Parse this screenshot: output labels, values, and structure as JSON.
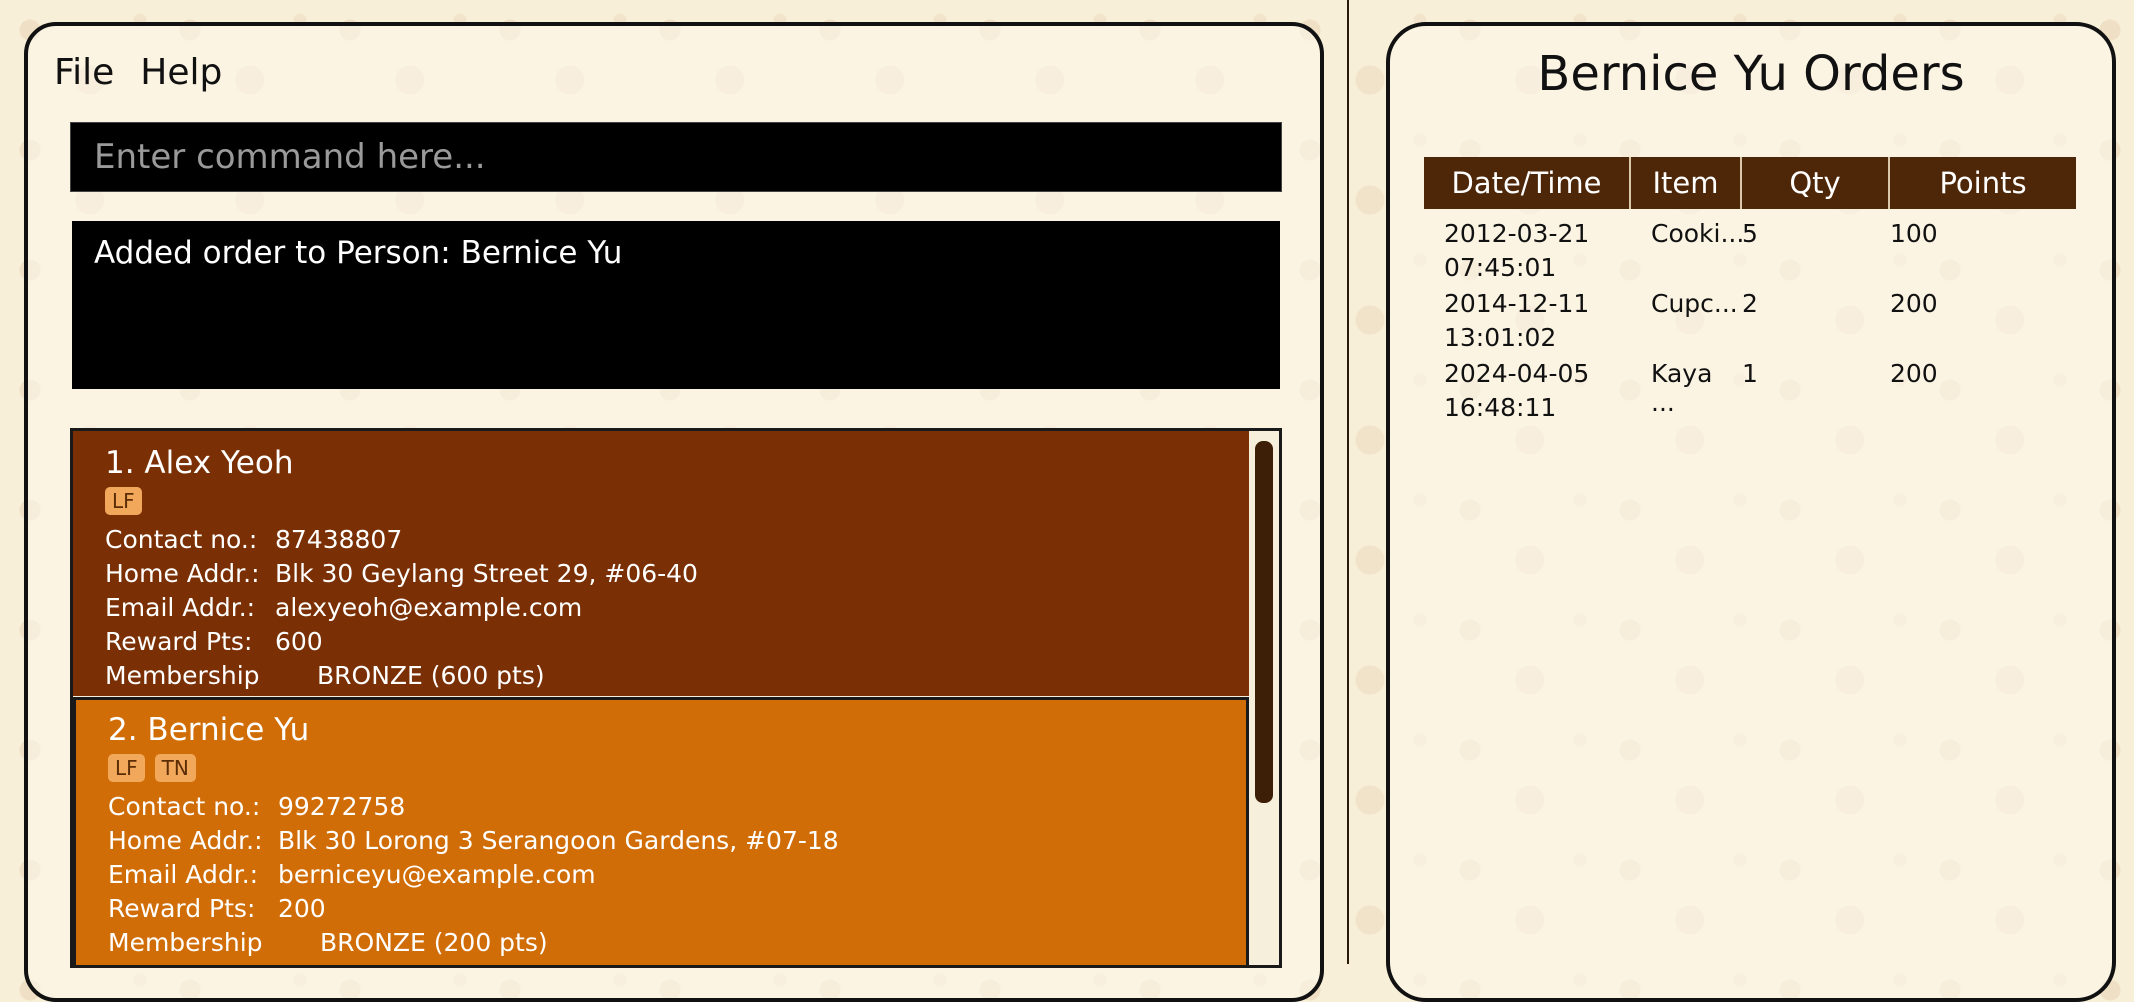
{
  "menu": {
    "file": "File",
    "help": "Help"
  },
  "command": {
    "placeholder": "Enter command here..."
  },
  "result": {
    "message": "Added order to Person: Bernice Yu"
  },
  "persons": [
    {
      "index_name": "1.  Alex Yeoh",
      "tags": [
        "LF"
      ],
      "contact_label": "Contact no.:",
      "contact": "87438807",
      "home_label": "Home Addr.:",
      "home": "Blk 30 Geylang Street 29, #06-40",
      "email_label": "Email Addr.:",
      "email": "alexyeoh@example.com",
      "points_label": "Reward Pts:",
      "points": "600",
      "tier_label": "Membership Tier:",
      "tier": "BRONZE (600 pts)"
    },
    {
      "index_name": "2.  Bernice Yu",
      "tags": [
        "LF",
        "TN"
      ],
      "contact_label": "Contact no.:",
      "contact": "99272758",
      "home_label": "Home Addr.:",
      "home": "Blk 30 Lorong 3 Serangoon Gardens, #07-18",
      "email_label": "Email Addr.:",
      "email": "berniceyu@example.com",
      "points_label": "Reward Pts:",
      "points": "200",
      "tier_label": "Membership Tier:",
      "tier": "BRONZE (200 pts)"
    }
  ],
  "orders": {
    "title": "Bernice Yu Orders",
    "headers": [
      "Date/Time",
      "Item",
      "Qty",
      "Points"
    ],
    "rows": [
      {
        "date": "2012-03-21",
        "time": "07:45:01",
        "item": "Cooki...",
        "qty": "5",
        "points": "100"
      },
      {
        "date": "2014-12-11",
        "time": "13:01:02",
        "item": "Cupc...",
        "qty": "2",
        "points": "200"
      },
      {
        "date": "2024-04-05",
        "time": "16:48:11",
        "item": "Kaya ...",
        "qty": "1",
        "points": "200"
      }
    ]
  },
  "colors": {
    "card_default": "#7a3004",
    "card_selected": "#d16d07",
    "table_header": "#4e2708",
    "tag_bg": "#f2a85a"
  }
}
